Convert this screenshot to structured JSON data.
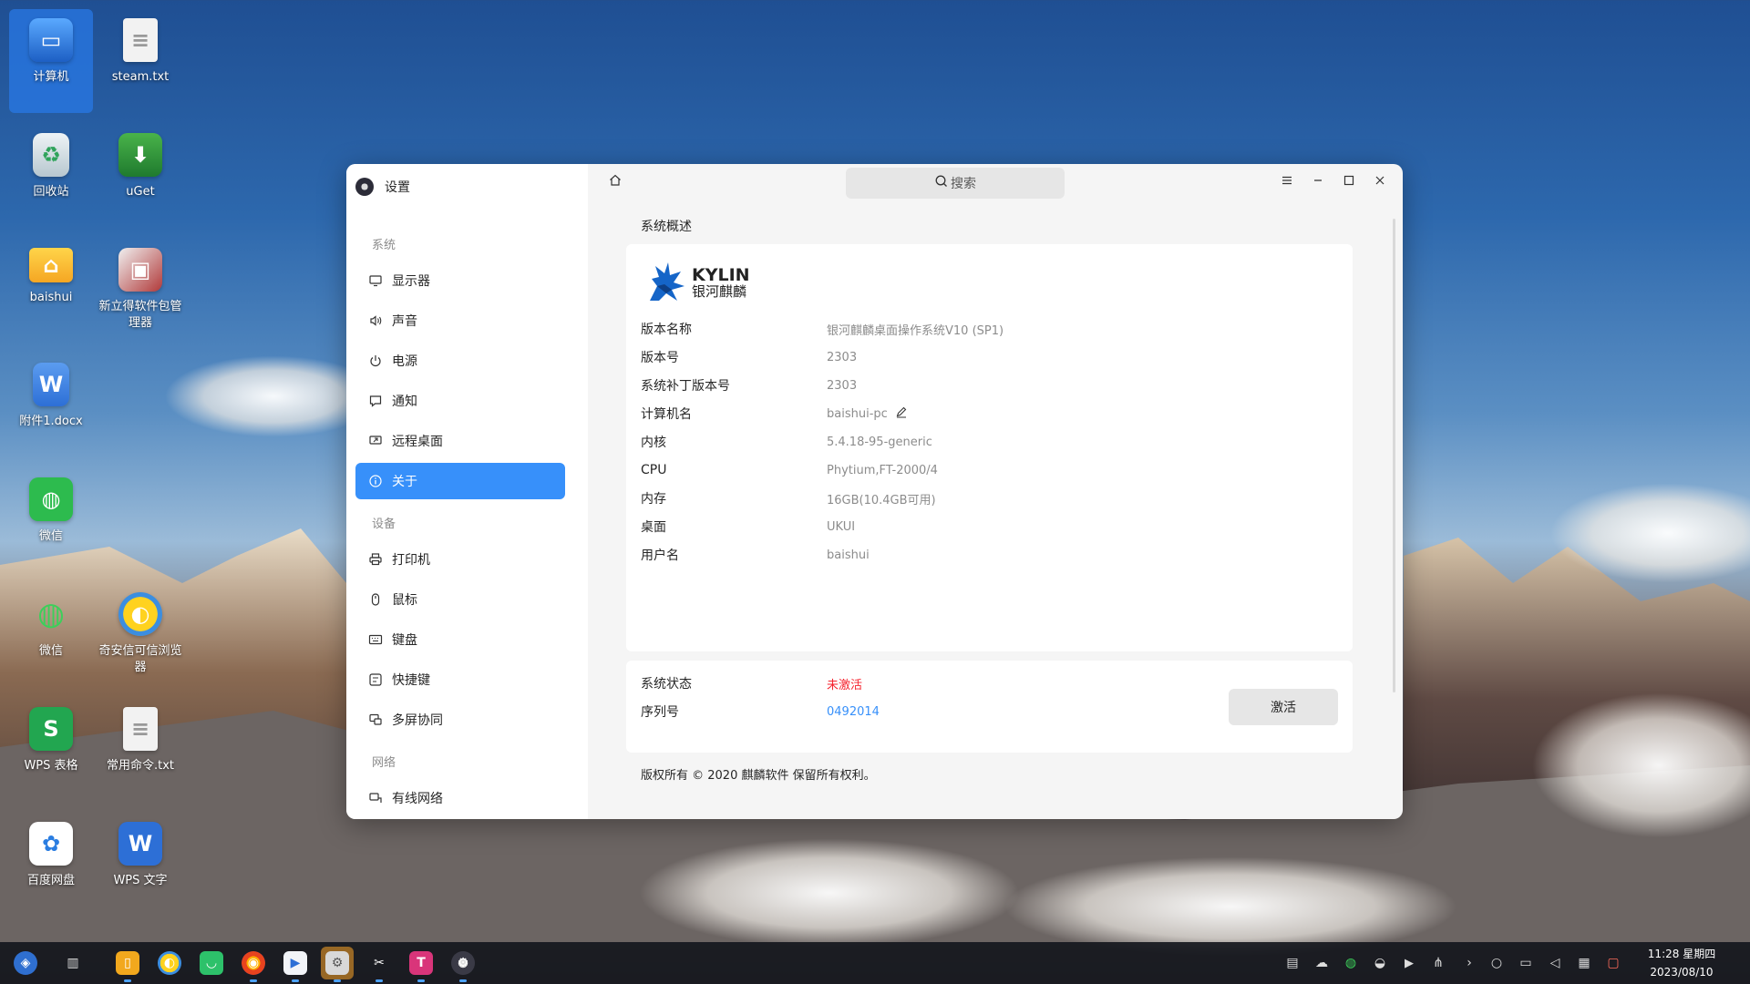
{
  "desktop": {
    "icons": [
      {
        "label": "计算机"
      },
      {
        "label": "steam.txt"
      },
      {
        "label": "回收站"
      },
      {
        "label": "uGet"
      },
      {
        "label": "baishui"
      },
      {
        "label": "新立得软件包管理器"
      },
      {
        "label": "附件1.docx"
      },
      {
        "label": "微信"
      },
      {
        "label": "微信"
      },
      {
        "label": "奇安信可信浏览器"
      },
      {
        "label": "WPS 表格"
      },
      {
        "label": "常用命令.txt"
      },
      {
        "label": "百度网盘"
      },
      {
        "label": "WPS 文字"
      }
    ]
  },
  "settings": {
    "app_title": "设置",
    "search_placeholder": "搜索",
    "nav": {
      "group_system": "系统",
      "display": "显示器",
      "sound": "声音",
      "power": "电源",
      "notify": "通知",
      "remote": "远程桌面",
      "about": "关于",
      "group_devices": "设备",
      "printer": "打印机",
      "mouse": "鼠标",
      "keyboard": "键盘",
      "shortcut": "快捷键",
      "multiscreen": "多屏协同",
      "group_network": "网络",
      "wired": "有线网络"
    },
    "section_title": "系统概述",
    "logo": {
      "en": "KYLIN",
      "cn": "银河麒麟"
    },
    "info": {
      "version_name_label": "版本名称",
      "version_name": "银河麒麟桌面操作系统V10 (SP1)",
      "version_label": "版本号",
      "version": "2303",
      "patch_label": "系统补丁版本号",
      "patch": "2303",
      "hostname_label": "计算机名",
      "hostname": "baishui-pc",
      "kernel_label": "内核",
      "kernel": "5.4.18-95-generic",
      "cpu_label": "CPU",
      "cpu": "Phytium,FT-2000/4",
      "memory_label": "内存",
      "memory": "16GB(10.4GB可用)",
      "desktop_label": "桌面",
      "desktop": "UKUI",
      "user_label": "用户名",
      "user": "baishui"
    },
    "status": {
      "state_label": "系统状态",
      "state": "未激活",
      "serial_label": "序列号",
      "serial": "0492014",
      "activate": "激活"
    },
    "copyright": "版权所有 © 2020 麒麟软件 保留所有权利。"
  },
  "taskbar": {
    "time": "11:28 星期四",
    "date": "2023/08/10"
  },
  "colors": {
    "accent": "#3790fa",
    "inactive_red": "#f5222d"
  }
}
